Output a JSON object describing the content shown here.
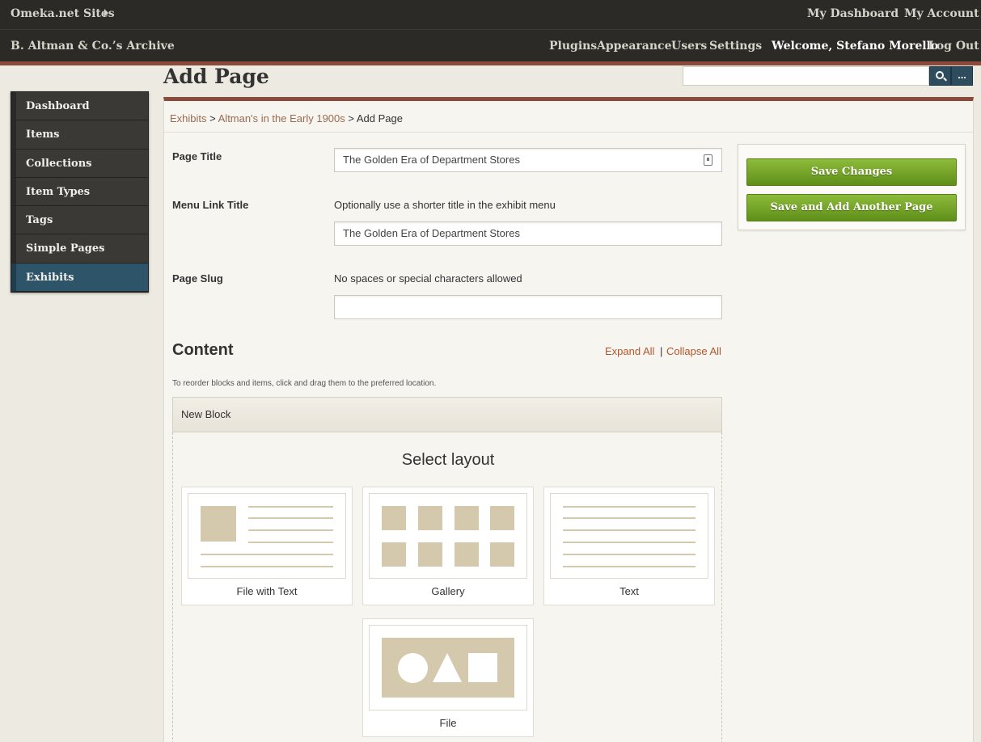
{
  "topbar": {
    "omeka_sites": "Omeka.net Sites",
    "my_dashboard": "My Dashboard",
    "my_account": "My Account"
  },
  "sitebar": {
    "site_title": "B. Altman & Co.’s Archive",
    "nav": [
      "Plugins",
      "Appearance",
      "Users",
      "Settings"
    ],
    "welcome": "Welcome, Stefano Morello",
    "logout": "Log Out"
  },
  "sidebar": {
    "items": [
      {
        "label": "Dashboard"
      },
      {
        "label": "Items"
      },
      {
        "label": "Collections"
      },
      {
        "label": "Item Types"
      },
      {
        "label": "Tags"
      },
      {
        "label": "Simple Pages"
      },
      {
        "label": "Exhibits"
      }
    ],
    "active": "Exhibits"
  },
  "page": {
    "title": "Add Page",
    "search_placeholder": "",
    "advanced_search_label": "..."
  },
  "breadcrumb": {
    "exhibits": "Exhibits",
    "sep1": " > ",
    "exhibit": "Altman's in the Early 1900s",
    "sep2": " > ",
    "current": "Add Page"
  },
  "form": {
    "page_title_label": "Page Title",
    "page_title_value": "The Golden Era of Department Stores",
    "menu_link_label": "Menu Link Title",
    "menu_link_hint": "Optionally use a shorter title in the exhibit menu",
    "menu_link_value": "The Golden Era of Department Stores",
    "slug_label": "Page Slug",
    "slug_hint": "No spaces or special characters allowed",
    "slug_value": ""
  },
  "content": {
    "heading": "Content",
    "expand_all": "Expand All",
    "pipe": "|",
    "collapse_all": "Collapse All",
    "reorder_hint": "To reorder blocks and items, click and drag them to the preferred location.",
    "block_title": "New Block",
    "select_layout": "Select layout",
    "layouts": [
      {
        "label": "File with Text"
      },
      {
        "label": "Gallery"
      },
      {
        "label": "Text"
      },
      {
        "label": "File"
      }
    ]
  },
  "actions": {
    "save_changes": "Save Changes",
    "save_and_add": "Save and Add Another Page"
  },
  "colors": {
    "topbar": "#2b2a26",
    "accent_red": "#8b4a3c",
    "active_nav": "#2d5469",
    "button_green": "#6e9e22",
    "link_orange": "#b5552c",
    "layout_tan": "#d4c8ad"
  }
}
